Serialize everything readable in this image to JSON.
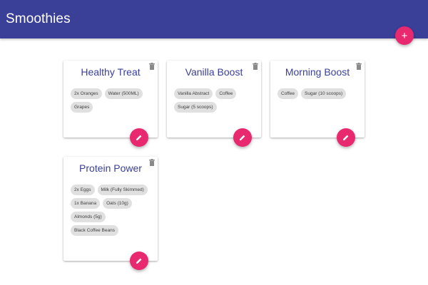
{
  "app": {
    "title": "Smoothies"
  },
  "fab_add": {
    "label": "+"
  },
  "smoothies": [
    {
      "name": "Healthy Treat",
      "ingredients": [
        "2x Oranges",
        "Water (500ML)",
        "Grapes"
      ]
    },
    {
      "name": "Vanilla Boost",
      "ingredients": [
        "Vanilla Abstract",
        "Coffee",
        "Sugar (5 scoops)"
      ]
    },
    {
      "name": "Morning Boost",
      "ingredients": [
        "Coffee",
        "Sugar (10 scoops)"
      ]
    },
    {
      "name": "Protein Power",
      "ingredients": [
        "2x Eggs",
        "Milk (Fully Skimmed)",
        "1x Banana",
        "Oats (10g)",
        "Almonds (5g)",
        "Black Coffee Beans"
      ]
    }
  ],
  "icons": {
    "add": "plus-icon",
    "delete": "trash-icon",
    "edit": "pencil-icon"
  },
  "colors": {
    "primary": "#3a3f98",
    "accent": "#e8286f",
    "chip": "#e0e0e0"
  }
}
